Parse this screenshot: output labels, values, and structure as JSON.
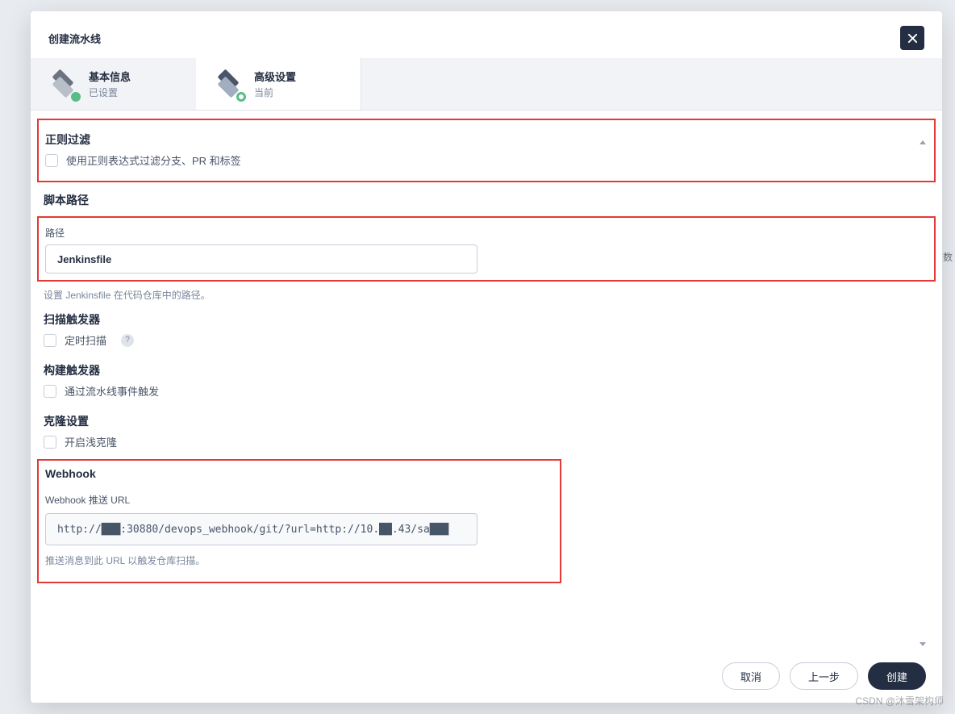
{
  "modal": {
    "title": "创建流水线"
  },
  "tabs": {
    "basic": {
      "label": "基本信息",
      "sub": "已设置"
    },
    "advanced": {
      "label": "高级设置",
      "sub": "当前"
    }
  },
  "regex_filter": {
    "title": "正则过滤",
    "checkbox_label": "使用正则表达式过滤分支、PR 和标签"
  },
  "script_path": {
    "title": "脚本路径",
    "field_label": "路径",
    "value": "Jenkinsfile",
    "help": "设置 Jenkinsfile 在代码仓库中的路径。"
  },
  "scan_trigger": {
    "title": "扫描触发器",
    "checkbox_label": "定时扫描"
  },
  "build_trigger": {
    "title": "构建触发器",
    "checkbox_label": "通过流水线事件触发"
  },
  "clone_settings": {
    "title": "克隆设置",
    "checkbox_label": "开启浅克隆"
  },
  "webhook": {
    "title": "Webhook",
    "field_label": "Webhook 推送 URL",
    "value": "http://███:30880/devops_webhook/git/?url=http://10.██.43/sa███",
    "help": "推送消息到此 URL 以触发仓库扫描。"
  },
  "footer": {
    "cancel": "取消",
    "prev": "上一步",
    "create": "创建"
  },
  "watermark": "CSDN @沐雪架构师",
  "bg_text": "数"
}
